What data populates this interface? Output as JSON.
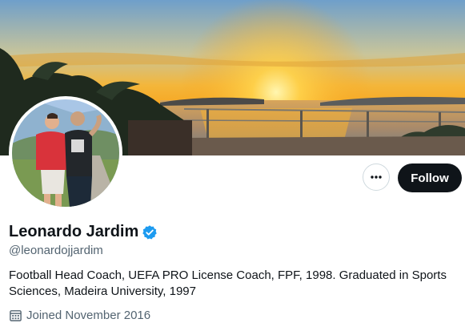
{
  "profile": {
    "name": "Leonardo Jardim",
    "handle": "@leonardojjardim",
    "bio": "Football Head Coach, UEFA PRO License Coach, FPF, 1998. Graduated in Sports Sciences, Madeira University, 1997",
    "joined": "Joined November 2016",
    "verified": true
  },
  "actions": {
    "more_icon": "more-horizontal-icon",
    "follow_label": "Follow"
  },
  "icons": {
    "verified": "verified-badge-icon",
    "calendar": "calendar-icon"
  },
  "colors": {
    "follow_bg": "#0f1419",
    "verified_blue": "#1d9bf0",
    "secondary_text": "#536471"
  }
}
